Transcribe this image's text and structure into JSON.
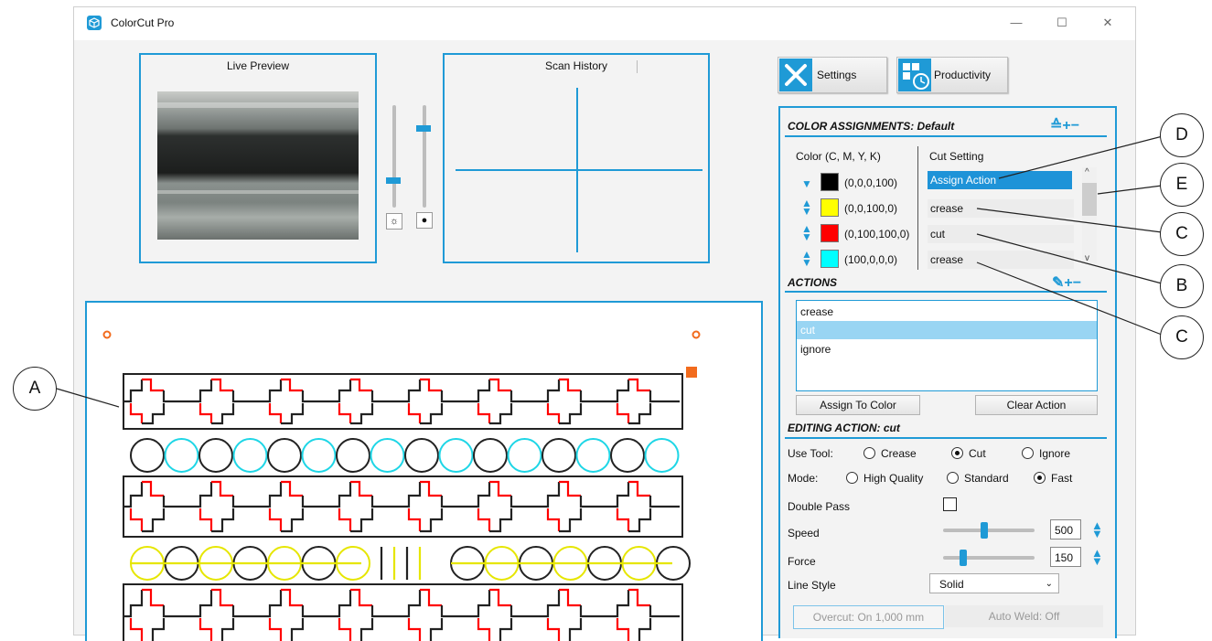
{
  "window": {
    "title": "ColorCut Pro",
    "controls": {
      "minimize": "—",
      "maximize": "☐",
      "close": "✕"
    }
  },
  "preview": {
    "title": "Live Preview",
    "brightness_icon": "sun-icon",
    "focus_icon": "aperture-icon"
  },
  "history": {
    "title": "Scan History"
  },
  "toolbar": {
    "settings_label": "Settings",
    "productivity_label": "Productivity"
  },
  "color_assignments": {
    "title": "COLOR ASSIGNMENTS: Default",
    "header_color": "Color (C, M, Y, K)",
    "header_cut": "Cut Setting",
    "header_icons": "≙+−",
    "rows": [
      {
        "swatch": "#000000",
        "value": "(0,0,0,100)",
        "cut": "Assign Action"
      },
      {
        "swatch": "#ffff00",
        "value": "(0,0,100,0)",
        "cut": "crease"
      },
      {
        "swatch": "#ff0000",
        "value": "(0,100,100,0)",
        "cut": "cut"
      },
      {
        "swatch": "#00ffff",
        "value": "(100,0,0,0)",
        "cut": "crease"
      }
    ]
  },
  "actions": {
    "title": "ACTIONS",
    "header_icons": "+−",
    "items": [
      "crease",
      "cut",
      "ignore"
    ],
    "selected": "cut",
    "assign_label": "Assign To Color",
    "clear_label": "Clear Action"
  },
  "editing": {
    "title": "EDITING ACTION: cut",
    "use_tool_label": "Use Tool:",
    "tool_options": [
      "Crease",
      "Cut",
      "Ignore"
    ],
    "tool_selected": "Cut",
    "mode_label": "Mode:",
    "mode_options": [
      "High Quality",
      "Standard",
      "Fast"
    ],
    "mode_selected": "Fast",
    "double_pass_label": "Double Pass",
    "double_pass": false,
    "speed_label": "Speed",
    "speed_value": "500",
    "speed_level": 0.45,
    "force_label": "Force",
    "force_value": "150",
    "force_level": 0.2,
    "line_style_label": "Line Style",
    "line_style_value": "Solid",
    "overcut_label": "Overcut: On 1,000 mm",
    "autoweld_label": "Auto Weld: Off"
  },
  "callouts": [
    "A",
    "B",
    "C",
    "C",
    "D",
    "E"
  ],
  "colors": {
    "accent": "#1f9ad6",
    "orange": "#f26b1d",
    "red": "#ff0000",
    "cyan": "#1ed6e6",
    "yellow": "#e6e600"
  }
}
